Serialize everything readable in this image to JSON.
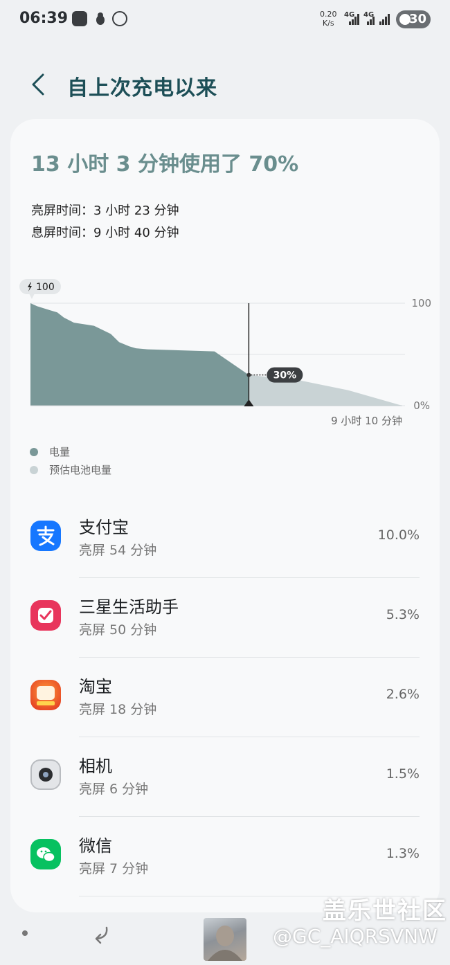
{
  "status_bar": {
    "time": "06:39",
    "net_speed_value": "0.20",
    "net_speed_unit": "K/s",
    "net1": "4G",
    "net2": "4G",
    "battery": "30"
  },
  "header": {
    "title": "自上次充电以来"
  },
  "summary": {
    "headline": "13 小时 3 分钟使用了 70%",
    "screen_on": "亮屏时间：3 小时 23 分钟",
    "screen_off": "息屏时间：9 小时 40 分钟"
  },
  "chart_data": {
    "type": "area",
    "start_badge": "100",
    "y_max_label": "100",
    "y_min_label": "0%",
    "ylim": [
      0,
      100
    ],
    "current_label": "30%",
    "remaining_label": "9 小时 10 分钟",
    "series": [
      {
        "name": "电量",
        "color": "#7a9898",
        "points": [
          [
            0,
            100
          ],
          [
            0.4,
            97
          ],
          [
            0.8,
            95
          ],
          [
            1.2,
            93
          ],
          [
            1.6,
            91
          ],
          [
            2.0,
            86
          ],
          [
            2.6,
            81
          ],
          [
            3.0,
            80
          ],
          [
            3.8,
            78
          ],
          [
            4.3,
            74
          ],
          [
            4.8,
            70
          ],
          [
            5.3,
            62
          ],
          [
            5.9,
            58
          ],
          [
            6.3,
            56
          ],
          [
            7.0,
            55
          ],
          [
            9.0,
            54
          ],
          [
            11.0,
            53
          ],
          [
            13.05,
            30
          ]
        ]
      },
      {
        "name": "预估电池电量",
        "color": "#c9d3d5",
        "points": [
          [
            13.05,
            30
          ],
          [
            16.0,
            25
          ],
          [
            19.0,
            15
          ],
          [
            22.22,
            0
          ]
        ]
      }
    ]
  },
  "legend": [
    {
      "label": "电量",
      "color": "#7a9898"
    },
    {
      "label": "预估电池电量",
      "color": "#c9d3d5"
    }
  ],
  "apps": [
    {
      "name": "支付宝",
      "sub": "亮屏 54 分钟",
      "pct": "10.0%",
      "icon": "alipay-icon",
      "color": "#1677ff"
    },
    {
      "name": "三星生活助手",
      "sub": "亮屏 50 分钟",
      "pct": "5.3%",
      "icon": "samsung-life-icon",
      "color": "#e8355c"
    },
    {
      "name": "淘宝",
      "sub": "亮屏 18 分钟",
      "pct": "2.6%",
      "icon": "taobao-icon",
      "color": "#ff5a1f"
    },
    {
      "name": "相机",
      "sub": "亮屏 6 分钟",
      "pct": "1.5%",
      "icon": "camera-icon",
      "color": "#8a8d92"
    },
    {
      "name": "微信",
      "sub": "亮屏 7 分钟",
      "pct": "1.3%",
      "icon": "wechat-icon",
      "color": "#07c160"
    }
  ],
  "watermark": {
    "title": "盖乐世社区",
    "user": "@GC_AIQRSVNW"
  }
}
